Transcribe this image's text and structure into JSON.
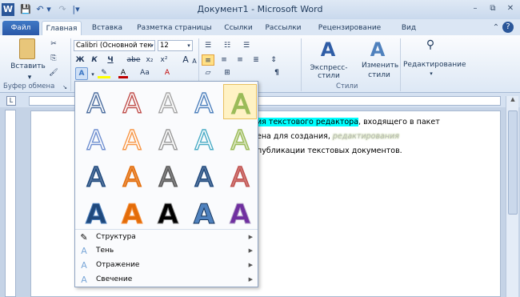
{
  "titlebar": {
    "title": "Документ1 - Microsoft Word",
    "qat": [
      "W",
      "💾",
      "↶",
      "▾",
      "↷",
      "|▾"
    ],
    "win_min": "–",
    "win_max": "⧉",
    "win_close": "✕"
  },
  "tabs": {
    "file": "Файл",
    "items": [
      "Главная",
      "Вставка",
      "Разметка страницы",
      "Ссылки",
      "Рассылки",
      "Рецензирование",
      "Вид"
    ]
  },
  "ribbon": {
    "clipboard": {
      "paste": "Вставить",
      "label": "Буфер обмена"
    },
    "font": {
      "name": "Calibri (Основной тек",
      "size": "12",
      "bold": "Ж",
      "italic": "К",
      "underline": "Ч",
      "strike": "abe",
      "sub": "x₂",
      "sup": "x²",
      "grow": "A",
      "shrink": "A",
      "case": "Aa",
      "clear": "A"
    },
    "styles": {
      "express": "Экспресс-стили",
      "change": "Изменить стили",
      "label": "Стили"
    },
    "editing": {
      "label": "Редактирование"
    }
  },
  "document": {
    "line1_hl": "ия текстового редактора",
    "line1_rest": ", входящего в пакет",
    "line2": "ена для создания,",
    "line2_fx": "редактирования",
    "line3": "публикации текстовых документов."
  },
  "menu": [
    {
      "label": "Структура",
      "icon": "pen-icon"
    },
    {
      "label": "Тень",
      "icon": "shadow-a-icon"
    },
    {
      "label": "Отражение",
      "icon": "reflection-a-icon"
    },
    {
      "label": "Свечение",
      "icon": "glow-a-icon"
    }
  ],
  "glyph": "A",
  "gallery_colors": [
    [
      "#ffffff",
      "#ffffff",
      "#ffffff",
      "#ffffff",
      "#ffffff"
    ],
    [
      "#ffffff",
      "#ffffff",
      "#ffffff",
      "#ffffff",
      "#ffffff"
    ],
    [
      "#ffffff",
      "#ffffff",
      "#ffffff",
      "#ffffff",
      "#ffffff"
    ],
    [
      "#1f497d",
      "#e36c09",
      "#000000",
      "#4f81bd",
      "#7030a0"
    ]
  ],
  "gallery_strokes": [
    [
      "#4e6fa0",
      "#c0504d",
      "#a6a6a6",
      "#4f81bd",
      "#9bbb59"
    ],
    [
      "#6f8fd0",
      "#f79646",
      "#9a9a9a",
      "#4bacc6",
      "#9bbb59"
    ],
    [
      "#1f497d",
      "#e36c09",
      "#595959",
      "#1f497d",
      "#c0504d"
    ],
    [
      "#4f81bd",
      "#f79646",
      "#7f7f7f",
      "#17365d",
      "#b2a1c7"
    ]
  ]
}
